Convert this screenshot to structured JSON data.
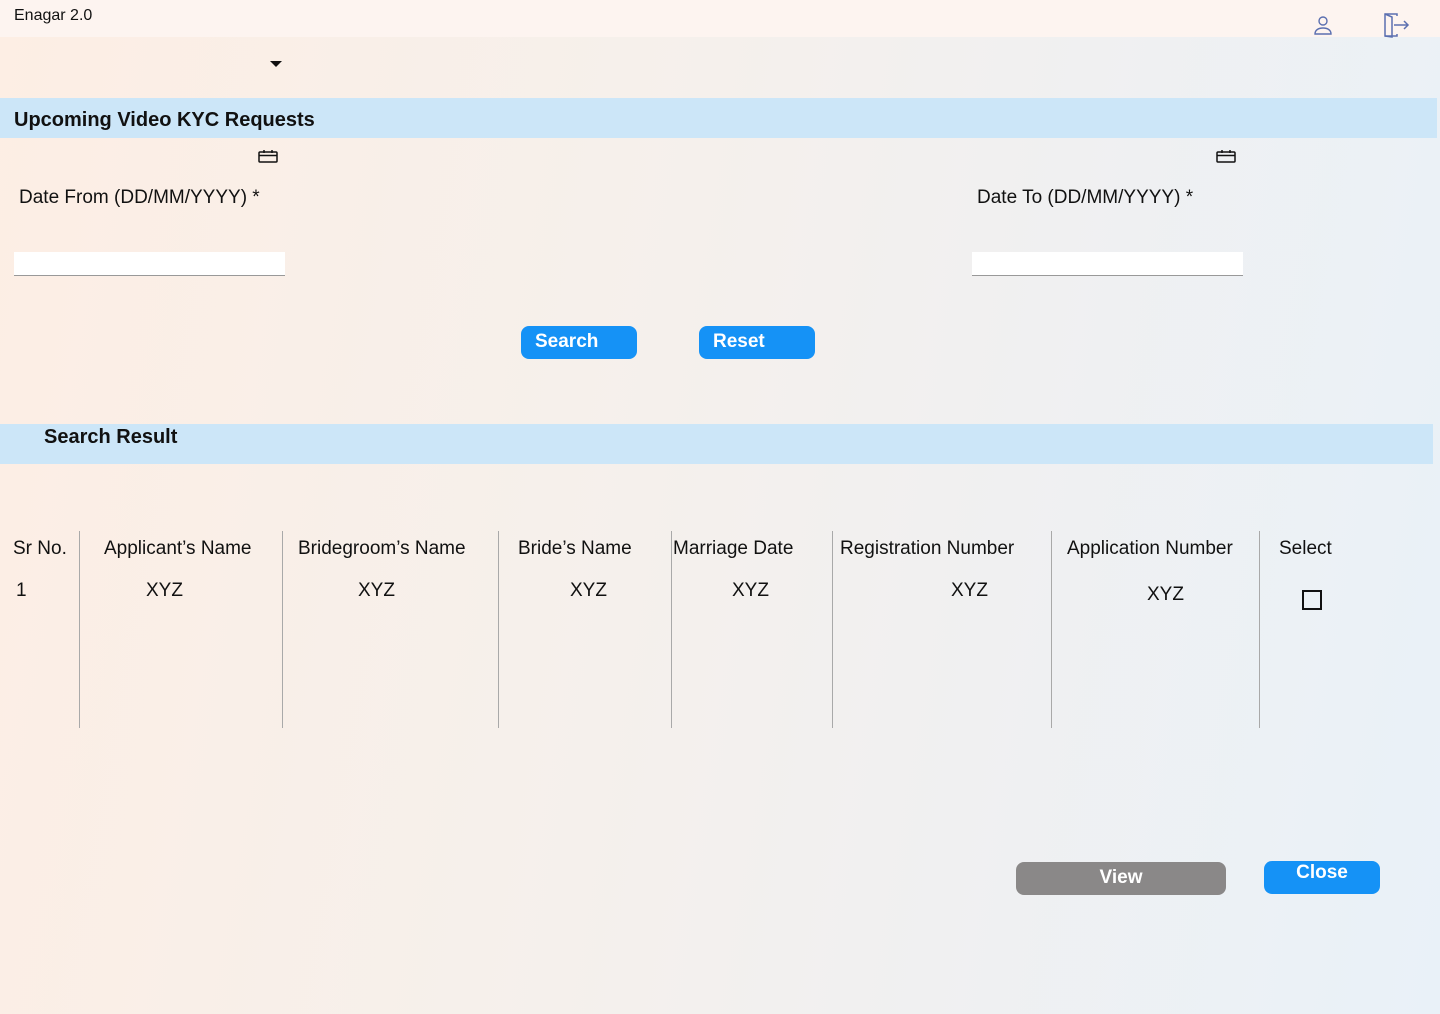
{
  "app": {
    "title": "Enagar 2.0"
  },
  "header": {
    "user_icon": "user-icon",
    "logout_icon": "logout-icon"
  },
  "page": {
    "title": "Upcoming Video KYC Requests",
    "date_from_label": "Date From (DD/MM/YYYY) *",
    "date_to_label": "Date To (DD/MM/YYYY) *",
    "date_from_value": "",
    "date_to_value": "",
    "search_button": "Search",
    "reset_button": "Reset"
  },
  "results": {
    "title": "Search Result",
    "columns": [
      "Sr No.",
      "Applicant’s Name",
      "Bridegroom’s Name",
      "Bride’s Name",
      "Marriage Date",
      "Registration Number",
      "Application Number",
      "Select"
    ],
    "rows": [
      {
        "sr_no": "1",
        "applicant": "XYZ",
        "bridegroom": "XYZ",
        "bride": "XYZ",
        "marriage_date": "XYZ",
        "registration_number": "XYZ",
        "application_number": "XYZ",
        "selected": false
      }
    ]
  },
  "footer": {
    "view_button": "View",
    "close_button": "Close"
  },
  "colors": {
    "primary_button": "#1592f6",
    "disabled_button": "#8a8888",
    "section_band": "#cce6f8"
  }
}
